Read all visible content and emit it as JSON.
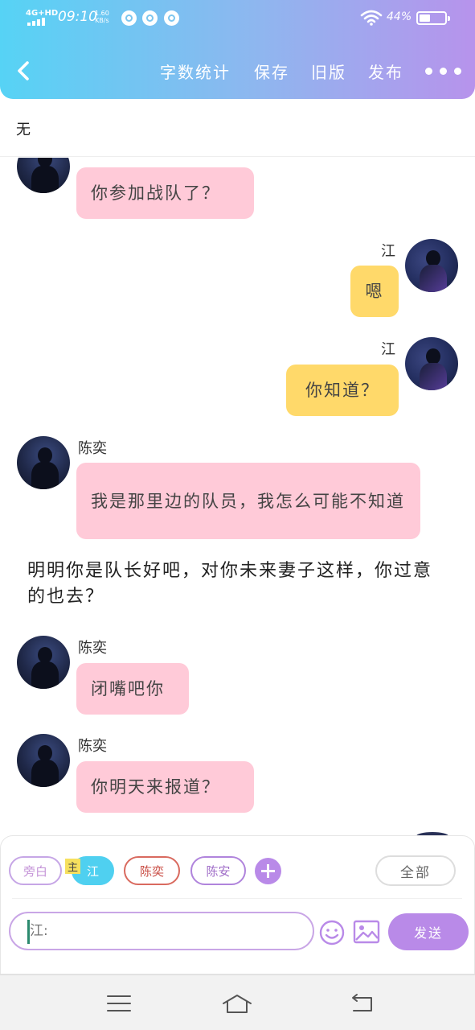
{
  "status_bar": {
    "network": "4G+HD",
    "time": "09:10",
    "speed_value": "1.60",
    "speed_unit": "KB/s",
    "battery_percent": "44%"
  },
  "toolbar": {
    "word_count": "字数统计",
    "save": "保存",
    "old_version": "旧版",
    "publish": "发布"
  },
  "chapter_title": "无",
  "messages": [
    {
      "side": "left",
      "speaker": "",
      "text": "你参加战队了？"
    },
    {
      "side": "right",
      "speaker": "江",
      "text": "嗯"
    },
    {
      "side": "right",
      "speaker": "江",
      "text": "你知道？"
    },
    {
      "side": "left",
      "speaker": "陈奕",
      "text": "我是那里边的队员，我怎么可能不知道"
    },
    {
      "side": "narration",
      "speaker": "",
      "text": "明明你是队长好吧，对你未来妻子这样，你过意的也去？"
    },
    {
      "side": "left",
      "speaker": "陈奕",
      "text": "闭嘴吧你"
    },
    {
      "side": "left",
      "speaker": "陈奕",
      "text": "你明天来报道？"
    }
  ],
  "roles": [
    {
      "label": "旁白",
      "active": false
    },
    {
      "label": "江",
      "active": true,
      "badge": "主"
    },
    {
      "label": "陈奕",
      "active": false
    },
    {
      "label": "陈安",
      "active": false
    }
  ],
  "all_label": "全部",
  "input": {
    "placeholder": "江:"
  },
  "send_label": "发送",
  "icons": {
    "back": "back-arrow-icon",
    "more": "more-dots-icon",
    "add_role": "plus-icon",
    "emoji": "smiley-icon",
    "image": "image-icon",
    "sys_menu": "menu-icon",
    "sys_home": "home-icon",
    "sys_back": "return-icon"
  },
  "colors": {
    "header_start": "#56d3f5",
    "header_end": "#b793ec",
    "bubble_left": "#ffcad8",
    "bubble_right": "#ffd96a",
    "accent": "#b98ae8"
  }
}
